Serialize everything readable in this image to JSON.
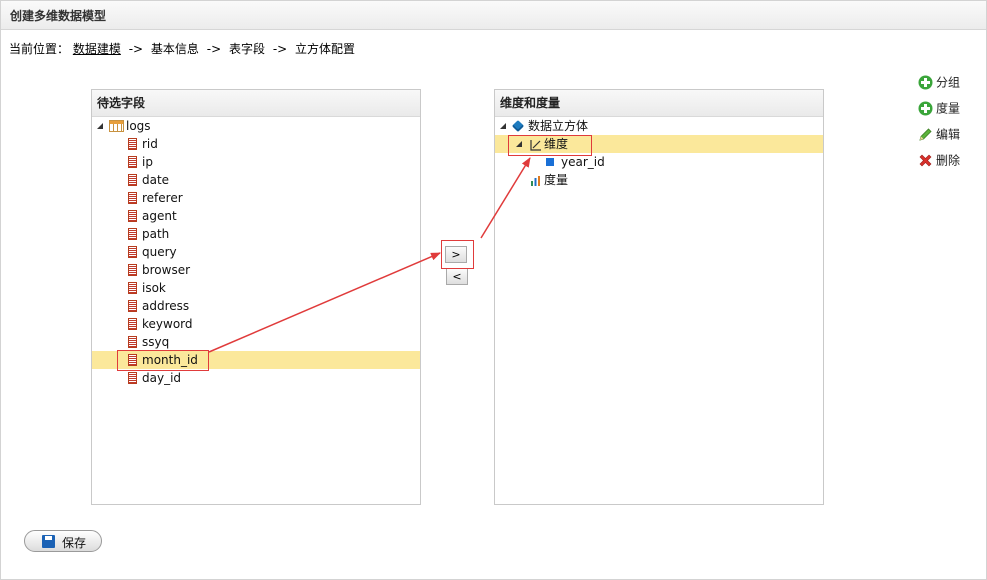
{
  "window": {
    "title": "创建多维数据模型"
  },
  "breadcrumb": {
    "prefix": "当前位置：",
    "link": "数据建模",
    "items": [
      "基本信息",
      "表字段",
      "立方体配置"
    ],
    "separator": "->"
  },
  "left_panel": {
    "title": "待选字段",
    "table": "logs",
    "fields": [
      "rid",
      "ip",
      "date",
      "referer",
      "agent",
      "path",
      "query",
      "browser",
      "isok",
      "address",
      "keyword",
      "ssyq",
      "month_id",
      "day_id"
    ],
    "selected_field": "month_id"
  },
  "right_panel": {
    "title": "维度和度量",
    "root": "数据立方体",
    "dimension_group": "维度",
    "dimension_items": [
      "year_id"
    ],
    "measure_group": "度量"
  },
  "transfer": {
    "add_label": ">",
    "remove_label": "<"
  },
  "actions": [
    {
      "label": "分组",
      "icon": "plus-icon"
    },
    {
      "label": "度量",
      "icon": "plus-icon"
    },
    {
      "label": "编辑",
      "icon": "pencil-icon"
    },
    {
      "label": "删除",
      "icon": "delete-icon"
    }
  ],
  "save": {
    "label": "保存"
  },
  "colors": {
    "selection": "#fbe89b",
    "annotation": "#e03b3b",
    "add_green": "#3aa53a",
    "delete_red": "#d9302b"
  }
}
